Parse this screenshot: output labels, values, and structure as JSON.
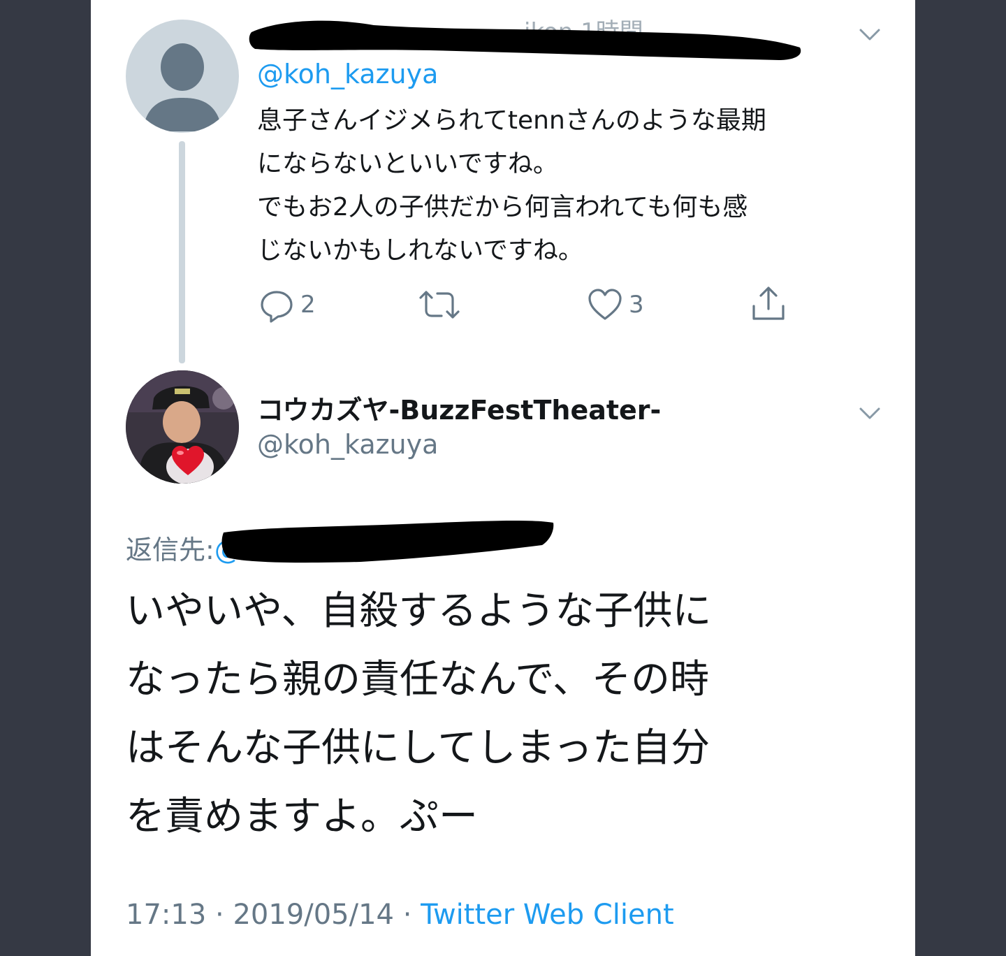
{
  "tweet1": {
    "name_partial": "ikon 1時間",
    "handle": "@koh_kazuya",
    "lines": [
      "息子さんイジメられてtennさんのような最期",
      "にならないといいですね。",
      "でもお2人の子供だから何言われても何も感",
      "じないかもしれないですね。"
    ],
    "reply_count": "2",
    "like_count": "3"
  },
  "tweet2": {
    "name": "コウカズヤ-BuzzFestTheater-",
    "handle": "@koh_kazuya",
    "reply_to_label": "返信先:",
    "reply_to_partial": "@",
    "lines": [
      "いやいや、自殺するような子供に",
      "なったら親の責任なんで、その時",
      "はそんな子供にしてしまった自分",
      "を責めますよ。ぷー"
    ],
    "time": "17:13",
    "sep1": " · ",
    "date": "2019/05/14",
    "sep2": " · ",
    "client": "Twitter Web Client"
  },
  "colors": {
    "accent": "#1d9bf0",
    "text": "#14171a",
    "muted": "#657786",
    "thread_line": "#ccd6dd",
    "frame": "#353944"
  },
  "icons": [
    "chevron-down-icon",
    "reply-icon",
    "retweet-icon",
    "like-icon",
    "share-icon",
    "default-avatar-icon",
    "heart-emoji-icon"
  ]
}
